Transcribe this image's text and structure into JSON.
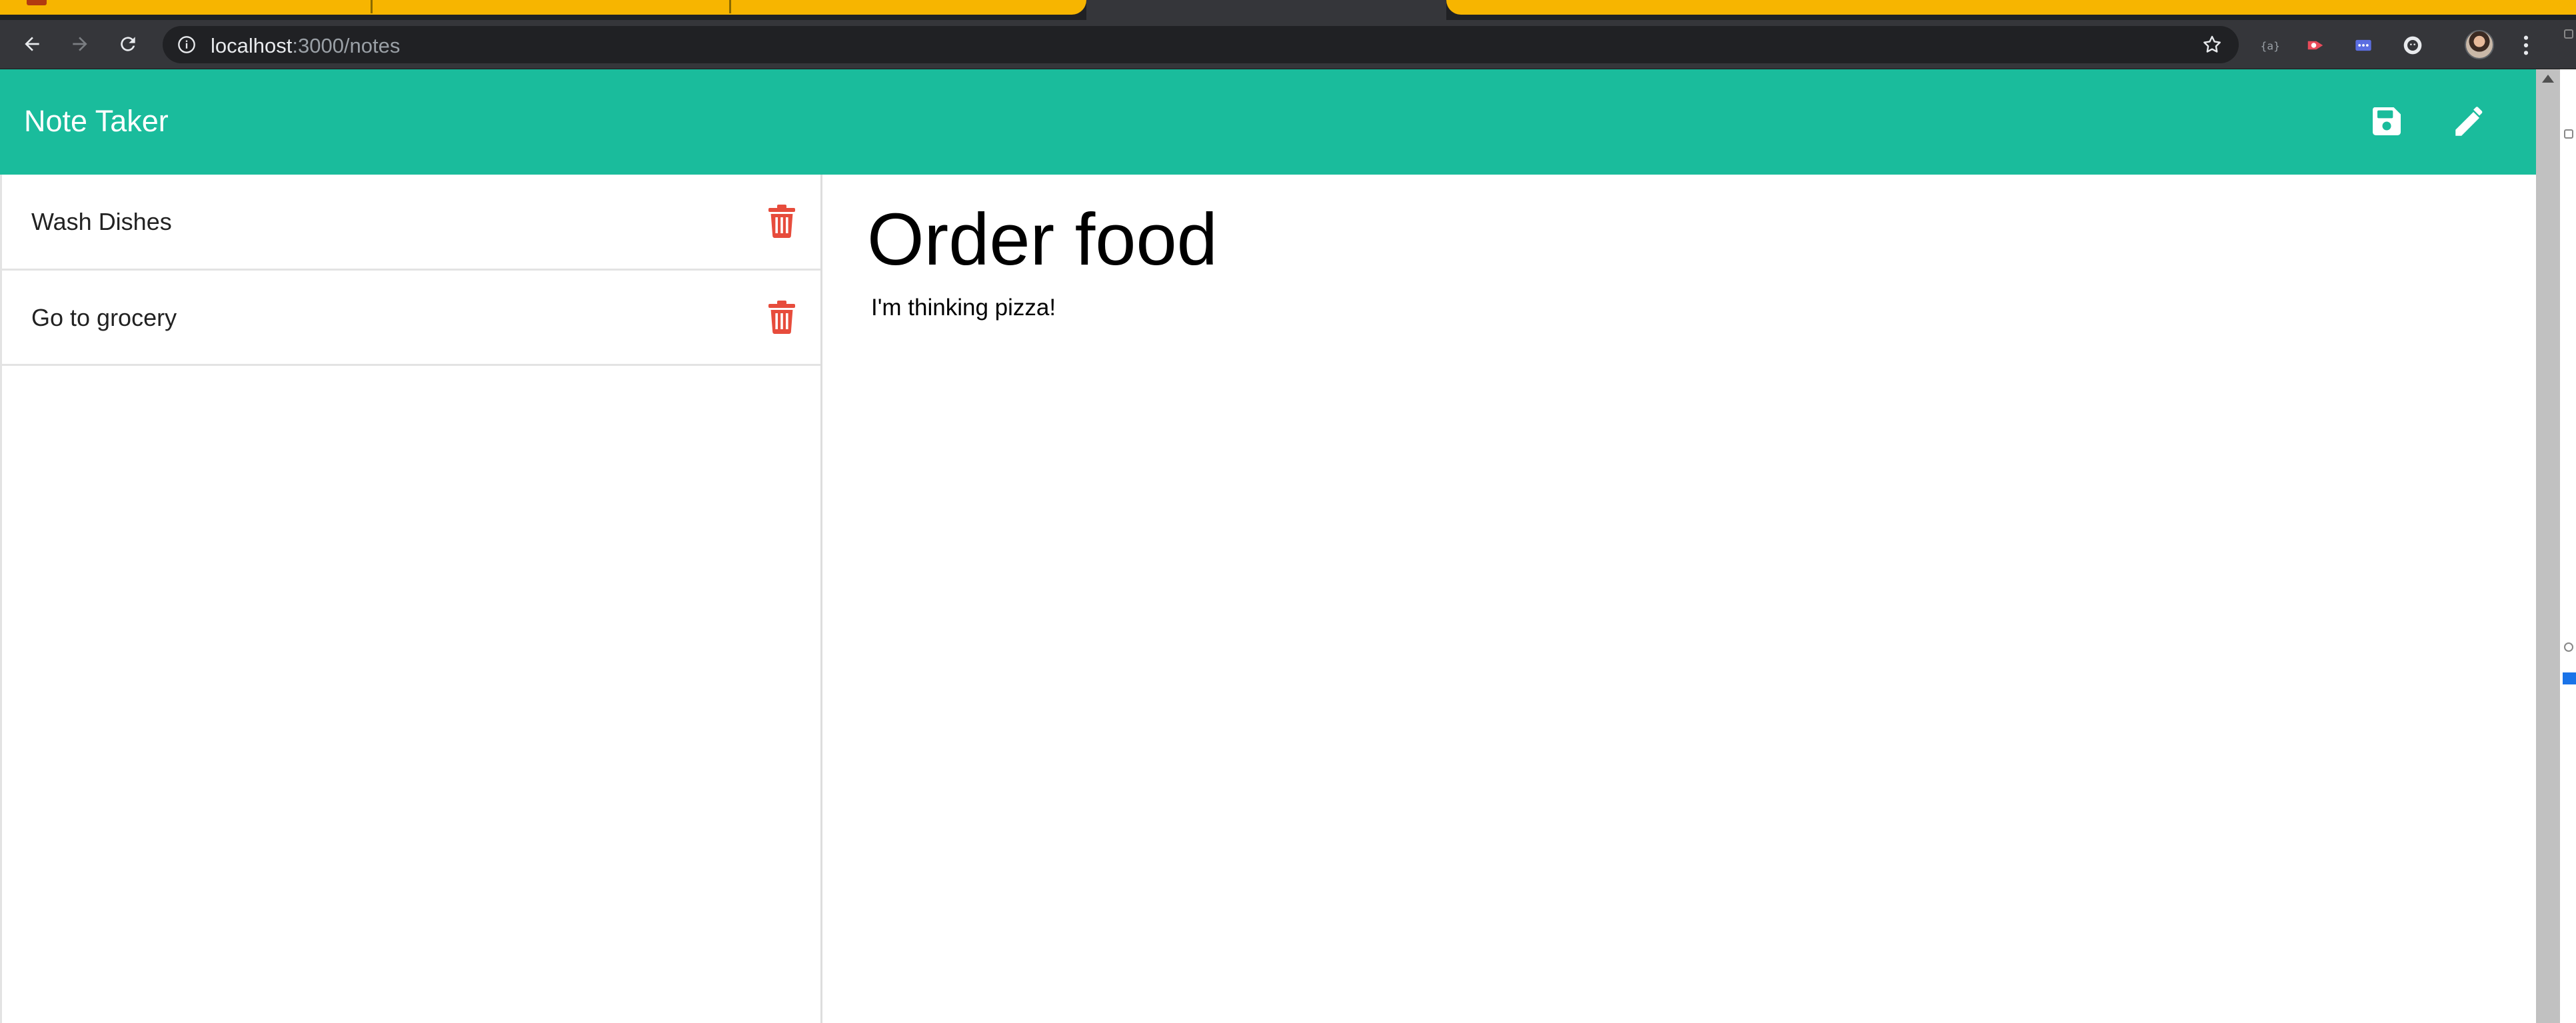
{
  "browser": {
    "url_host": "localhost",
    "url_path": ":3000/notes"
  },
  "app": {
    "title": "Note Taker"
  },
  "notes_list": [
    {
      "title": "Wash Dishes"
    },
    {
      "title": "Go to grocery"
    }
  ],
  "active_note": {
    "title": "Order food",
    "text": "I'm thinking pizza!"
  },
  "colors": {
    "header": "#1abc9c",
    "trash": "#e74c3c"
  }
}
